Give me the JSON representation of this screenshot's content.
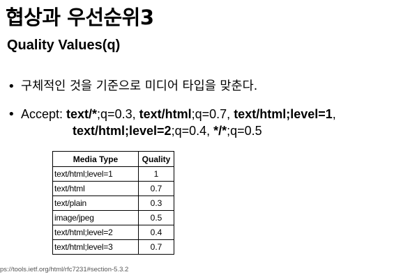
{
  "slide": {
    "title": "협상과 우선순위3",
    "subtitle": "Quality Values(q)",
    "bullet_marker": "•",
    "bullet1": "구체적인 것을 기준으로 미디어 타입을 맞춘다.",
    "bullet2": {
      "label": "Accept: ",
      "p1_bold": "text/*",
      "p1_rest": ";q=0.3, ",
      "p2_bold": "text/html",
      "p2_rest": ";q=0.7, ",
      "p3_bold": "text/html;level=1",
      "p3_rest": ",",
      "p4_bold": "text/html;level=2",
      "p4_rest": ";q=0.4, ",
      "p5_bold": "*/*",
      "p5_rest": ";q=0.5"
    },
    "footer_url": "ps://tools.ietf.org/html/rfc7231#section-5.3.2"
  },
  "table": {
    "headers": [
      "Media Type",
      "Quality"
    ],
    "rows": [
      [
        "text/html;level=1",
        "1"
      ],
      [
        "text/html",
        "0.7"
      ],
      [
        "text/plain",
        "0.3"
      ],
      [
        "image/jpeg",
        "0.5"
      ],
      [
        "text/html;level=2",
        "0.4"
      ],
      [
        "text/html;level=3",
        "0.7"
      ]
    ]
  }
}
